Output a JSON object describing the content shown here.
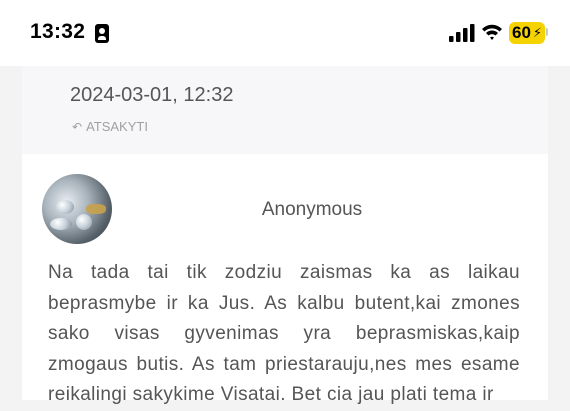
{
  "status_bar": {
    "time": "13:32",
    "battery_level": "60"
  },
  "reply": {
    "date": "2024-03-01, 12:32",
    "reply_label": "ATSAKYTI"
  },
  "comment": {
    "author": "Anonymous",
    "text": "Na tada tai tik zodziu zaismas ka as laikau beprasmybe ir ka Jus. As kalbu butent,kai zmones sako visas gyvenimas yra beprasmiskas,kaip zmogaus butis. As tam priestarauju,nes mes esame reikalingi sakykime Visatai. Bet cia jau plati tema ir"
  },
  "colors": {
    "battery": "#f5d300",
    "text": "#555555",
    "muted": "#a0a0a0"
  }
}
